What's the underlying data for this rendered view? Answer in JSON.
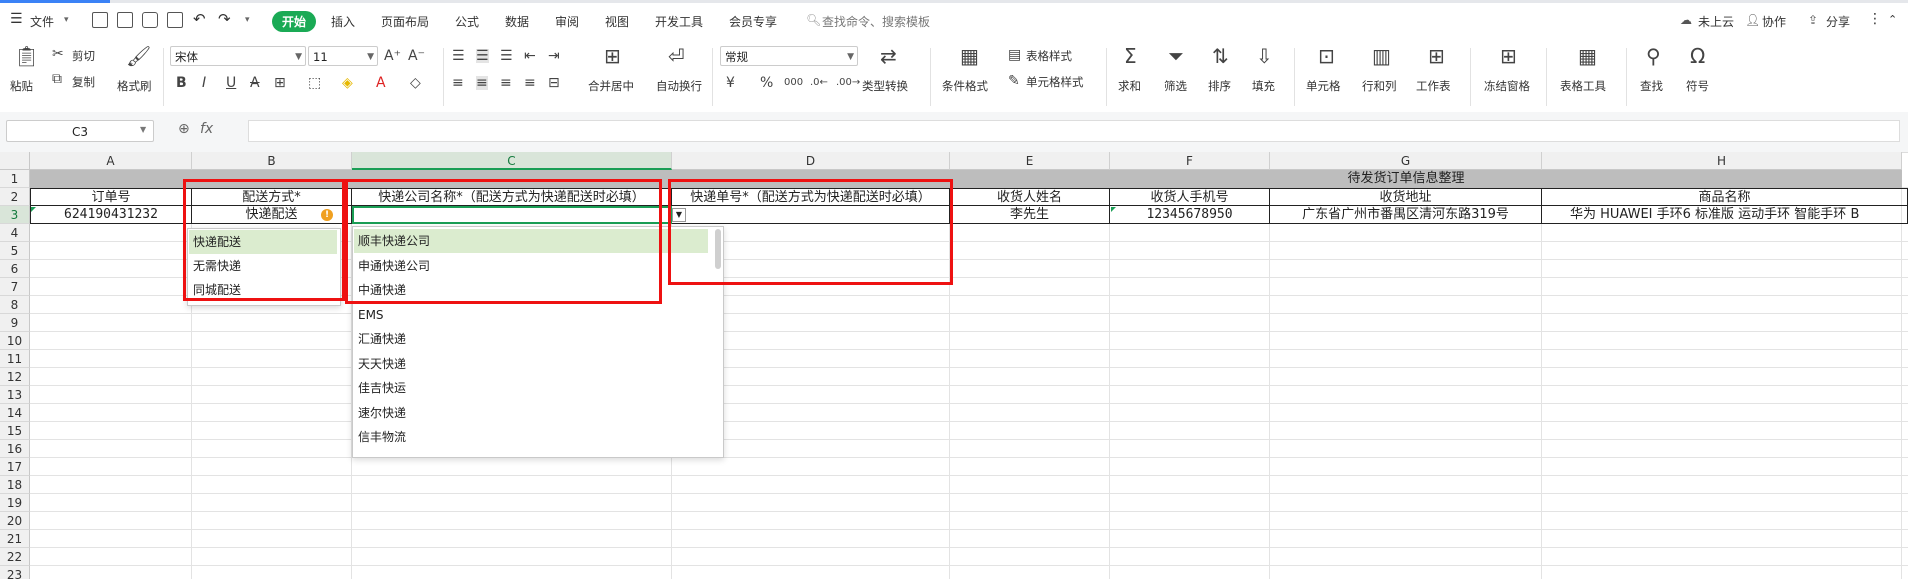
{
  "menubar": {
    "file": "文件",
    "tabs": [
      "开始",
      "插入",
      "页面布局",
      "公式",
      "数据",
      "审阅",
      "视图",
      "开发工具",
      "会员专享"
    ],
    "active_tab": "开始",
    "search_placeholder": "查找命令、搜索模板",
    "cloud": "未上云",
    "collab": "协作",
    "share": "分享"
  },
  "ribbon": {
    "paste": "粘贴",
    "cut": "剪切",
    "copy": "复制",
    "format_painter": "格式刷",
    "font_name": "宋体",
    "font_size": "11",
    "merge": "合并居中",
    "wrap": "自动换行",
    "number_format": "常规",
    "type_convert": "类型转换",
    "cond_format": "条件格式",
    "table_style": "表格样式",
    "cell_style": "单元格样式",
    "sum": "求和",
    "filter": "筛选",
    "sort": "排序",
    "fill": "填充",
    "cell": "单元格",
    "rowcol": "行和列",
    "sheet": "工作表",
    "freeze": "冻结窗格",
    "table_tools": "表格工具",
    "find": "查找",
    "symbol": "符号"
  },
  "formula_bar": {
    "name_box": "C3",
    "fx": "fx",
    "content": ""
  },
  "grid": {
    "columns": [
      "A",
      "B",
      "C",
      "D",
      "E",
      "F",
      "G",
      "H"
    ],
    "rows": [
      "1",
      "2",
      "3",
      "4",
      "5",
      "6",
      "7",
      "8",
      "9",
      "10",
      "11",
      "12",
      "13",
      "14",
      "15",
      "16",
      "17",
      "18",
      "19",
      "20",
      "21",
      "22",
      "23"
    ],
    "selected_col": "C",
    "selected_row": "3",
    "title": "待发货订单信息整理",
    "headers": [
      "订单号",
      "配送方式*",
      "快递公司名称*（配送方式为快递配送时必填）",
      "快递单号*（配送方式为快递配送时必填）",
      "收货人姓名",
      "收货人手机号",
      "收货地址",
      "商品名称"
    ],
    "row3": [
      "624190431232",
      "快递配送",
      "",
      "",
      "李先生",
      "12345678950",
      "广东省广州市番禺区清河东路319号",
      "华为 HUAWEI 手环6 标准版 运动手环 智能手环 B"
    ]
  },
  "dropdown_b": {
    "items": [
      "快递配送",
      "无需快递",
      "同城配送"
    ],
    "selected": "快递配送"
  },
  "dropdown_c": {
    "items": [
      "顺丰快递公司",
      "申通快递公司",
      "中通快递",
      "EMS",
      "汇通快递",
      "天天快递",
      "佳吉快运",
      "速尔快递",
      "信丰物流"
    ],
    "selected": "顺丰快递公司"
  },
  "colors": {
    "accent": "#1aaa55",
    "highlight_box": "#e11111",
    "title_band": "#bdbdbd"
  }
}
